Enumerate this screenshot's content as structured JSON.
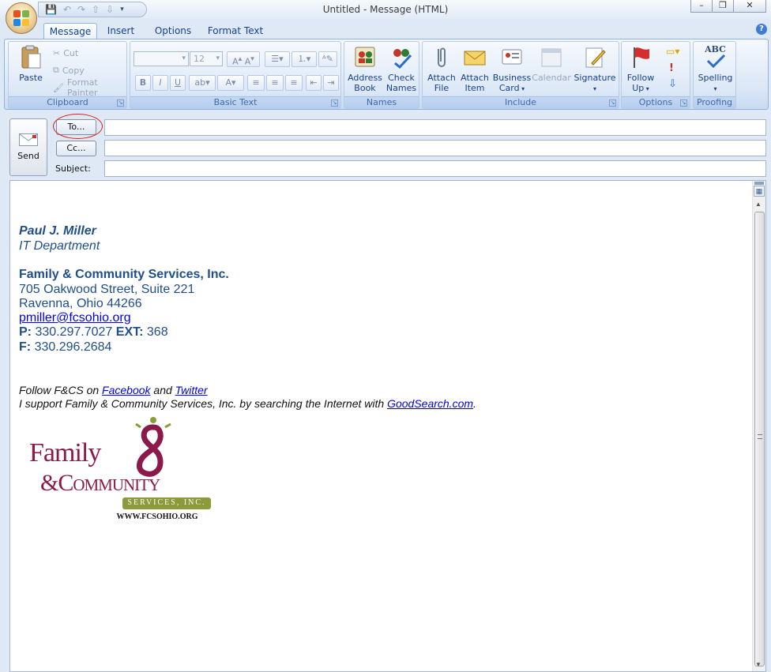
{
  "window": {
    "title": "Untitled - Message (HTML)"
  },
  "quick_access": {
    "save_icon": "save-icon",
    "undo_icon": "undo-icon",
    "redo_icon": "redo-icon",
    "up_icon": "up-icon",
    "down_icon": "down-icon"
  },
  "tabs": [
    {
      "label": "Message"
    },
    {
      "label": "Insert"
    },
    {
      "label": "Options"
    },
    {
      "label": "Format Text"
    }
  ],
  "ribbon": {
    "clipboard": {
      "label": "Clipboard",
      "paste": "Paste",
      "cut": "Cut",
      "copy": "Copy",
      "format_painter": "Format Painter"
    },
    "basic_text": {
      "label": "Basic Text",
      "font_size": "12"
    },
    "names": {
      "label": "Names",
      "address_book": [
        "Address",
        "Book"
      ],
      "check_names": [
        "Check",
        "Names"
      ]
    },
    "include": {
      "label": "Include",
      "attach_file": [
        "Attach",
        "File"
      ],
      "attach_item": [
        "Attach",
        "Item"
      ],
      "business_card": [
        "Business",
        "Card"
      ],
      "calendar": "Calendar",
      "signature": "Signature"
    },
    "options": {
      "label": "Options",
      "follow_up": [
        "Follow",
        "Up"
      ]
    },
    "proofing": {
      "label": "Proofing",
      "spelling": "Spelling",
      "abc": "ABC"
    }
  },
  "compose": {
    "send": "Send",
    "to_button": "To...",
    "cc_button": "Cc...",
    "subject_label": "Subject:",
    "to_value": "",
    "cc_value": "",
    "subject_value": ""
  },
  "signature": {
    "name": "Paul J. Miller",
    "department": "IT Department",
    "org": "Family & Community Services, Inc.",
    "address1": "705 Oakwood Street, Suite 221",
    "address2": "Ravenna, Ohio 44266",
    "email": "pmiller@fcsohio.org",
    "phone_label": "P:",
    "phone": "330.297.7027",
    "ext_label": "EXT:",
    "ext": "368",
    "fax_label": "F:",
    "fax": "330.296.2684",
    "follow_prefix": "Follow F&CS on",
    "facebook": "Facebook",
    "and": "and",
    "twitter": "Twitter",
    "support_text": "I support Family & Community Services, Inc. by searching the Internet with",
    "goodsearch": "GoodSearch.com",
    "period": "."
  },
  "logo": {
    "line1": "Family",
    "line2": "&Community",
    "line3": "SERVICES, INC.",
    "url": "WWW.FCSOHIO.ORG",
    "maroon": "#8b1a4a",
    "olive": "#8c9a3a"
  },
  "colors": {
    "signature_blue": "#1f4e8c",
    "annotation_red": "#e0201b"
  }
}
